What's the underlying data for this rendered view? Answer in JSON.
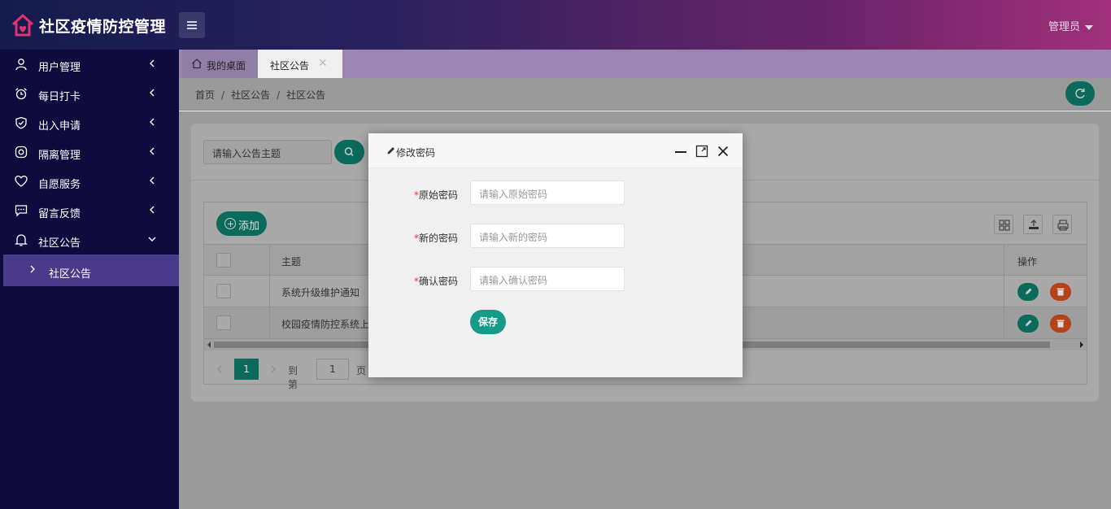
{
  "app": {
    "title": "社区疫情防控管理",
    "user": "管理员"
  },
  "sidebar": {
    "items": [
      {
        "label": "用户管理",
        "icon": "user-icon"
      },
      {
        "label": "每日打卡",
        "icon": "alarm-clock-icon"
      },
      {
        "label": "出入申请",
        "icon": "shield-check-icon"
      },
      {
        "label": "隔离管理",
        "icon": "target-icon"
      },
      {
        "label": "自愿服务",
        "icon": "heart-icon"
      },
      {
        "label": "留言反馈",
        "icon": "message-icon"
      },
      {
        "label": "社区公告",
        "icon": "bell-icon"
      }
    ],
    "sub_item": "社区公告"
  },
  "tabs": [
    {
      "label": "我的桌面"
    },
    {
      "label": "社区公告"
    }
  ],
  "breadcrumb": [
    "首页",
    "社区公告",
    "社区公告"
  ],
  "search": {
    "placeholder": "请输入公告主题"
  },
  "toolbar": {
    "add_label": "添加"
  },
  "table": {
    "columns": [
      "主题",
      "操作"
    ],
    "rows": [
      {
        "subject": "系统升级维护通知"
      },
      {
        "subject": "校园疫情防控系统上"
      }
    ]
  },
  "pager": {
    "current": "1",
    "goto_label": "到第",
    "page_input": "1",
    "page_suffix": "页"
  },
  "modal": {
    "title": "修改密码",
    "fields": [
      {
        "label": "原始密码",
        "placeholder": "请输入原始密码"
      },
      {
        "label": "新的密码",
        "placeholder": "请输入新的密码"
      },
      {
        "label": "确认密码",
        "placeholder": "请输入确认密码"
      }
    ],
    "required_mark": "*",
    "save_label": "保存"
  },
  "colors": {
    "accent": "#0a6a5c",
    "danger": "#b5421a",
    "sidebar": "#0f0b3f",
    "modal_save": "#169a8a"
  }
}
